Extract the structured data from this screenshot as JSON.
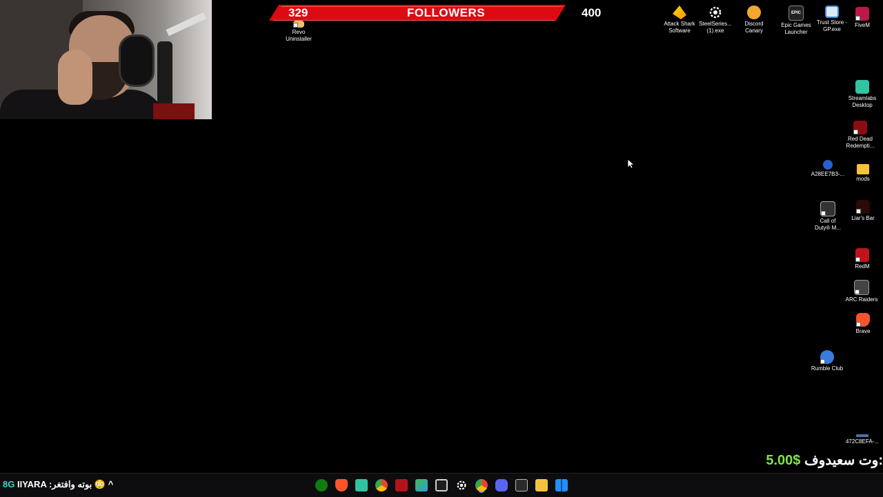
{
  "followers": {
    "current": "329",
    "label": "FOLLOWERS",
    "goal": "400",
    "bar_color": "#dd0a12"
  },
  "desktop_icons": [
    {
      "label": "Revo\nUninstaller"
    },
    {
      "label": "Attack Shark\nSoftware"
    },
    {
      "label": "SteelSeries...\n(1).exe"
    },
    {
      "label": "Discord\nCanary"
    },
    {
      "label": "Epic Games\nLauncher"
    },
    {
      "label": "Trust Store -\nGP.exe"
    },
    {
      "label": "FiveM"
    },
    {
      "label": "Streamlabs\nDesktop"
    },
    {
      "label": "Red Dead\nRedempti..."
    },
    {
      "label": "A28EE7B3-..."
    },
    {
      "label": "mods"
    },
    {
      "label": "Call of\nDuty® M..."
    },
    {
      "label": "Liar's Bar"
    },
    {
      "label": "RedM"
    },
    {
      "label": "ARC Raiders"
    },
    {
      "label": "Brave"
    },
    {
      "label": "Rumble Club"
    },
    {
      "label": "472C8EFA-..."
    }
  ],
  "donation": {
    "text": "وت سعيدوف:",
    "amount": "5.00$"
  },
  "ticker": {
    "badge": "8G",
    "text": "IIYARA :بوته وافتغر 😳",
    "caret": "^"
  },
  "taskbar_icons": [
    "xbox-icon",
    "brave-icon",
    "streamlabs-icon",
    "chrome-color-icon",
    "red-app-icon",
    "widgets-icon",
    "window-icon",
    "steelseries-icon",
    "chrome-icon",
    "discord-icon",
    "store-icon",
    "file-explorer-icon",
    "windows-icon"
  ]
}
